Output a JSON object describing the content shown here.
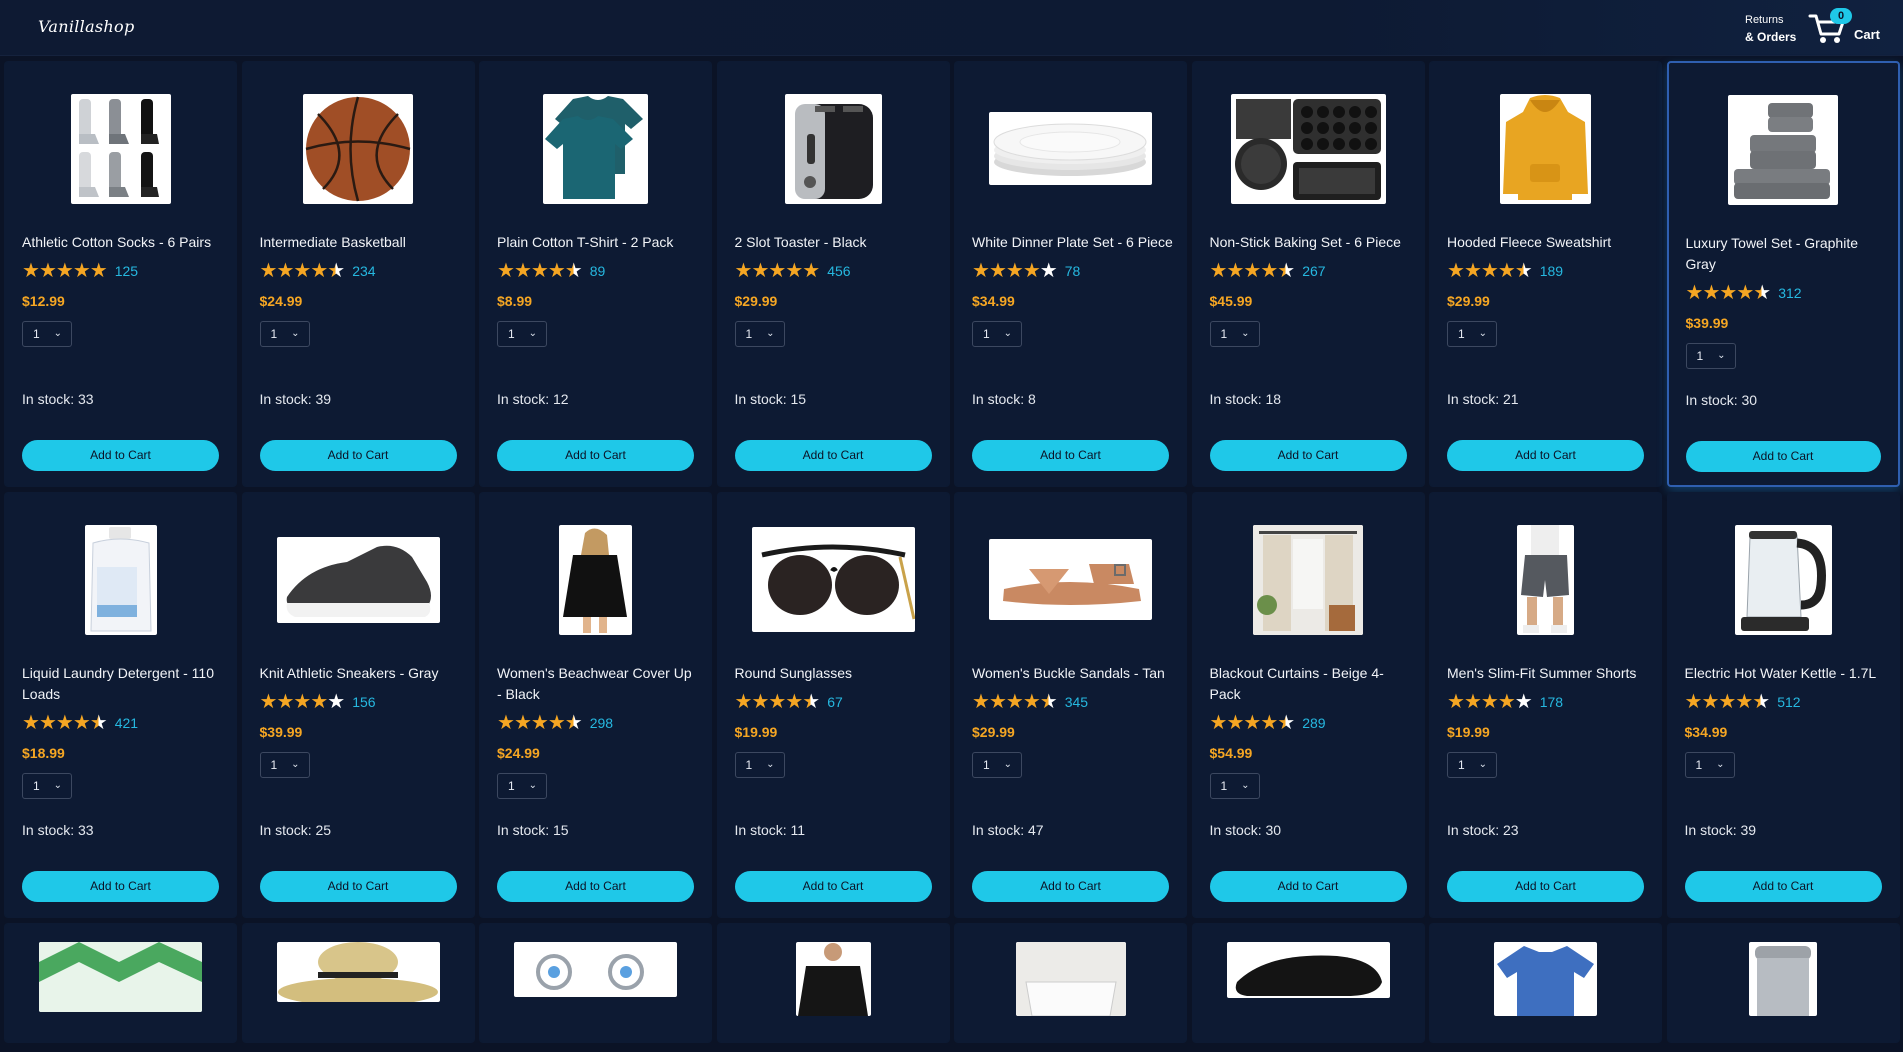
{
  "header": {
    "logo": "Vanillashop",
    "returns_line1": "Returns",
    "returns_line2": "& Orders",
    "cart_count": "0",
    "cart_label": "Cart"
  },
  "products": [
    {
      "title": "Athletic Cotton Socks - 6 Pairs",
      "stars": 5,
      "reviews": "125",
      "price": "$12.99",
      "qty": "1",
      "stock": "In stock: 33",
      "button": "Add to Cart",
      "image": "socks-image"
    },
    {
      "title": "Intermediate Basketball",
      "stars": 4.5,
      "reviews": "234",
      "price": "$24.99",
      "qty": "1",
      "stock": "In stock: 39",
      "button": "Add to Cart",
      "image": "basketball-image"
    },
    {
      "title": "Plain Cotton T-Shirt - 2 Pack",
      "stars": 4.5,
      "reviews": "89",
      "price": "$8.99",
      "qty": "1",
      "stock": "In stock: 12",
      "button": "Add to Cart",
      "image": "tshirt-image"
    },
    {
      "title": "2 Slot Toaster - Black",
      "stars": 5,
      "reviews": "456",
      "price": "$29.99",
      "qty": "1",
      "stock": "In stock: 15",
      "button": "Add to Cart",
      "image": "toaster-image"
    },
    {
      "title": "White Dinner Plate Set - 6 Piece",
      "stars": 4,
      "reviews": "78",
      "price": "$34.99",
      "qty": "1",
      "stock": "In stock: 8",
      "button": "Add to Cart",
      "image": "plates-image"
    },
    {
      "title": "Non-Stick Baking Set - 6 Piece",
      "stars": 4.5,
      "reviews": "267",
      "price": "$45.99",
      "qty": "1",
      "stock": "In stock: 18",
      "button": "Add to Cart",
      "image": "baking-set-image"
    },
    {
      "title": "Hooded Fleece Sweatshirt",
      "stars": 4.5,
      "reviews": "189",
      "price": "$29.99",
      "qty": "1",
      "stock": "In stock: 21",
      "button": "Add to Cart",
      "image": "hoodie-image"
    },
    {
      "title": "Luxury Towel Set - Graphite Gray",
      "stars": 4.5,
      "reviews": "312",
      "price": "$39.99",
      "qty": "1",
      "stock": "In stock: 30",
      "button": "Add to Cart",
      "image": "towels-image"
    },
    {
      "title": "Liquid Laundry Detergent - 110 Loads",
      "stars": 4.5,
      "reviews": "421",
      "price": "$18.99",
      "qty": "1",
      "stock": "In stock: 33",
      "button": "Add to Cart",
      "image": "detergent-image"
    },
    {
      "title": "Knit Athletic Sneakers - Gray",
      "stars": 4,
      "reviews": "156",
      "price": "$39.99",
      "qty": "1",
      "stock": "In stock: 25",
      "button": "Add to Cart",
      "image": "sneakers-image"
    },
    {
      "title": "Women's Beachwear Cover Up - Black",
      "stars": 4.5,
      "reviews": "298",
      "price": "$24.99",
      "qty": "1",
      "stock": "In stock: 15",
      "button": "Add to Cart",
      "image": "coverup-image"
    },
    {
      "title": "Round Sunglasses",
      "stars": 4.5,
      "reviews": "67",
      "price": "$19.99",
      "qty": "1",
      "stock": "In stock: 11",
      "button": "Add to Cart",
      "image": "sunglasses-image"
    },
    {
      "title": "Women's Buckle Sandals - Tan",
      "stars": 4.5,
      "reviews": "345",
      "price": "$29.99",
      "qty": "1",
      "stock": "In stock: 47",
      "button": "Add to Cart",
      "image": "sandals-image"
    },
    {
      "title": "Blackout Curtains - Beige 4-Pack",
      "stars": 4.5,
      "reviews": "289",
      "price": "$54.99",
      "qty": "1",
      "stock": "In stock: 30",
      "button": "Add to Cart",
      "image": "curtains-image"
    },
    {
      "title": "Men's Slim-Fit Summer Shorts",
      "stars": 4,
      "reviews": "178",
      "price": "$19.99",
      "qty": "1",
      "stock": "In stock: 23",
      "button": "Add to Cart",
      "image": "shorts-image"
    },
    {
      "title": "Electric Hot Water Kettle - 1.7L",
      "stars": 4.5,
      "reviews": "512",
      "price": "$34.99",
      "qty": "1",
      "stock": "In stock: 39",
      "button": "Add to Cart",
      "image": "kettle-image"
    }
  ],
  "partial_row_images": [
    "tissue-box-image",
    "straw-hat-image",
    "flower-earrings-image",
    "black-sweater-image",
    "bathtub-image",
    "black-flats-image",
    "polo-shirt-image",
    "trash-can-image"
  ],
  "colors": {
    "accent": "#1fc8e8",
    "star": "#f5a623",
    "background": "#0b1326",
    "card": "#0d1a33",
    "review_count": "#26b8e0"
  }
}
